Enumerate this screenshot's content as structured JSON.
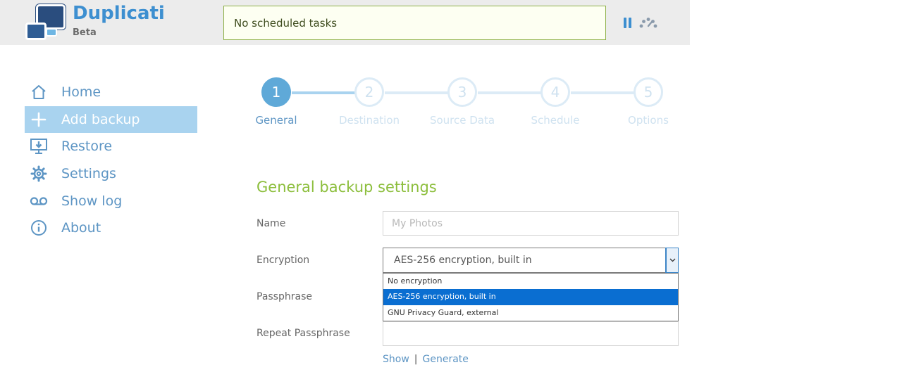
{
  "brand": {
    "name": "Duplicati",
    "subtitle": "Beta"
  },
  "header": {
    "status": "No scheduled tasks"
  },
  "sidebar": {
    "items": [
      {
        "label": "Home",
        "icon": "home-icon",
        "active": false
      },
      {
        "label": "Add backup",
        "icon": "plus-icon",
        "active": true
      },
      {
        "label": "Restore",
        "icon": "restore-icon",
        "active": false
      },
      {
        "label": "Settings",
        "icon": "gear-icon",
        "active": false
      },
      {
        "label": "Show log",
        "icon": "voicemail-icon",
        "active": false
      },
      {
        "label": "About",
        "icon": "info-icon",
        "active": false
      }
    ]
  },
  "wizard": {
    "steps": [
      {
        "number": "1",
        "label": "General"
      },
      {
        "number": "2",
        "label": "Destination"
      },
      {
        "number": "3",
        "label": "Source Data"
      },
      {
        "number": "4",
        "label": "Schedule"
      },
      {
        "number": "5",
        "label": "Options"
      }
    ],
    "active_step": 1
  },
  "form": {
    "title": "General backup settings",
    "name_label": "Name",
    "name_placeholder": "My Photos",
    "encryption_label": "Encryption",
    "encryption_selected": "AES-256 encryption, built in",
    "encryption_options": [
      "No encryption",
      "AES-256 encryption, built in",
      "GNU Privacy Guard, external"
    ],
    "passphrase_label": "Passphrase",
    "repeat_passphrase_label": "Repeat Passphrase",
    "show_link": "Show",
    "link_separator": "|",
    "generate_link": "Generate"
  },
  "colors": {
    "accent": "#3d8fd0",
    "sidebar_active": "#a9d3ef",
    "form_title": "#8cbe3c",
    "selected_option": "#0a6ed1"
  }
}
